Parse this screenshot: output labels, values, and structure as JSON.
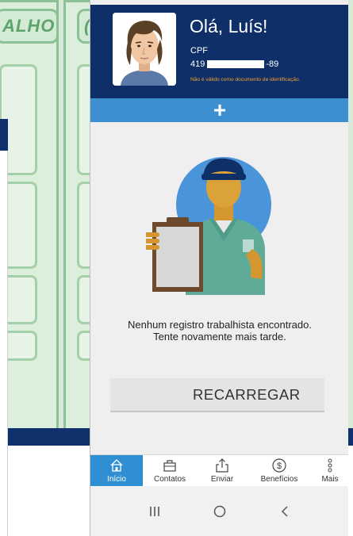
{
  "background": {
    "banner_text_left": "ALHO",
    "banner_text_right": "("
  },
  "header": {
    "greeting": "Olá, Luís!",
    "cpf_label": "CPF",
    "cpf_prefix": "419",
    "cpf_suffix": "-89",
    "disclaimer": "Não é válido como documento de identificação."
  },
  "add_bar": {
    "icon": "plus-icon",
    "label": "+"
  },
  "empty_state": {
    "message": "Nenhum registro trabalhista encontrado. Tente novamente mais tarde."
  },
  "reload_button": {
    "label": "RECARREGAR"
  },
  "tabs": [
    {
      "label": "Início",
      "icon": "home-icon",
      "active": true
    },
    {
      "label": "Contatos",
      "icon": "briefcase-icon",
      "active": false
    },
    {
      "label": "Enviar",
      "icon": "share-icon",
      "active": false
    },
    {
      "label": "Benefícios",
      "icon": "dollar-circle-icon",
      "active": false
    },
    {
      "label": "Mais",
      "icon": "more-vertical-icon",
      "active": false
    }
  ],
  "system_nav": [
    "recent-apps-icon",
    "home-circle-icon",
    "back-chevron-icon"
  ],
  "colors": {
    "header_bg": "#0e2f67",
    "accent_blue": "#3d8fd0",
    "active_tab": "#2f8fd2",
    "disclaimer": "#f2a12e"
  }
}
